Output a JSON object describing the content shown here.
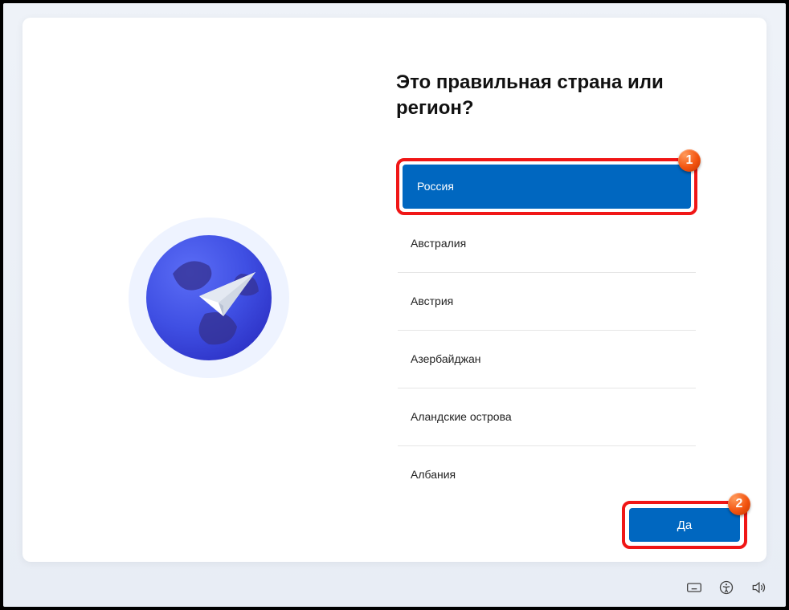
{
  "heading": "Это правильная страна или регион?",
  "countries": {
    "selected": "Россия",
    "items": [
      "Австралия",
      "Австрия",
      "Азербайджан",
      "Аландские острова",
      "Албания"
    ]
  },
  "yes_button": "Да",
  "annotations": {
    "badge1": "1",
    "badge2": "2"
  },
  "colors": {
    "accent": "#0067c0",
    "highlight": "#f01616"
  }
}
